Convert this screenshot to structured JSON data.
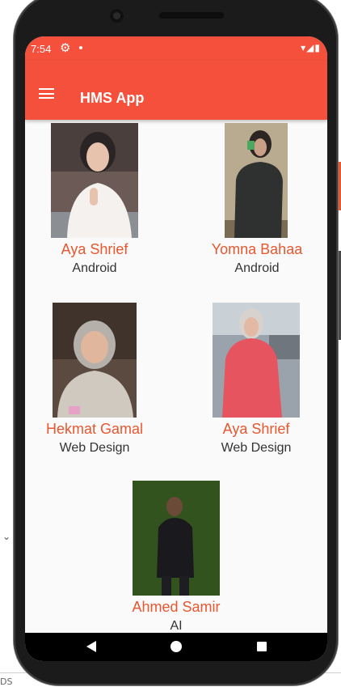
{
  "ide": {
    "chevron_glyph": "⌄",
    "bottom_text": "DS"
  },
  "status_bar": {
    "time": "7:54",
    "icons_right": "▾◢▮",
    "settings_icon": "gear-icon"
  },
  "app_bar": {
    "title": "HMS App",
    "menu_icon": "hamburger-menu-icon"
  },
  "theme": {
    "primary": "#f4503b",
    "name_color": "#e8572f",
    "role_color": "#333333"
  },
  "team": [
    {
      "name": "Aya Shrief",
      "role": "Android"
    },
    {
      "name": "Yomna Bahaa",
      "role": "Android"
    },
    {
      "name": "Hekmat Gamal",
      "role": "Web Design"
    },
    {
      "name": "Aya Shrief",
      "role": "Web Design"
    },
    {
      "name": "Ahmed Samir",
      "role": "AI"
    }
  ],
  "nav_bar": {
    "back_icon": "back-triangle-icon",
    "home_icon": "home-circle-icon",
    "recents_icon": "recents-square-icon"
  }
}
